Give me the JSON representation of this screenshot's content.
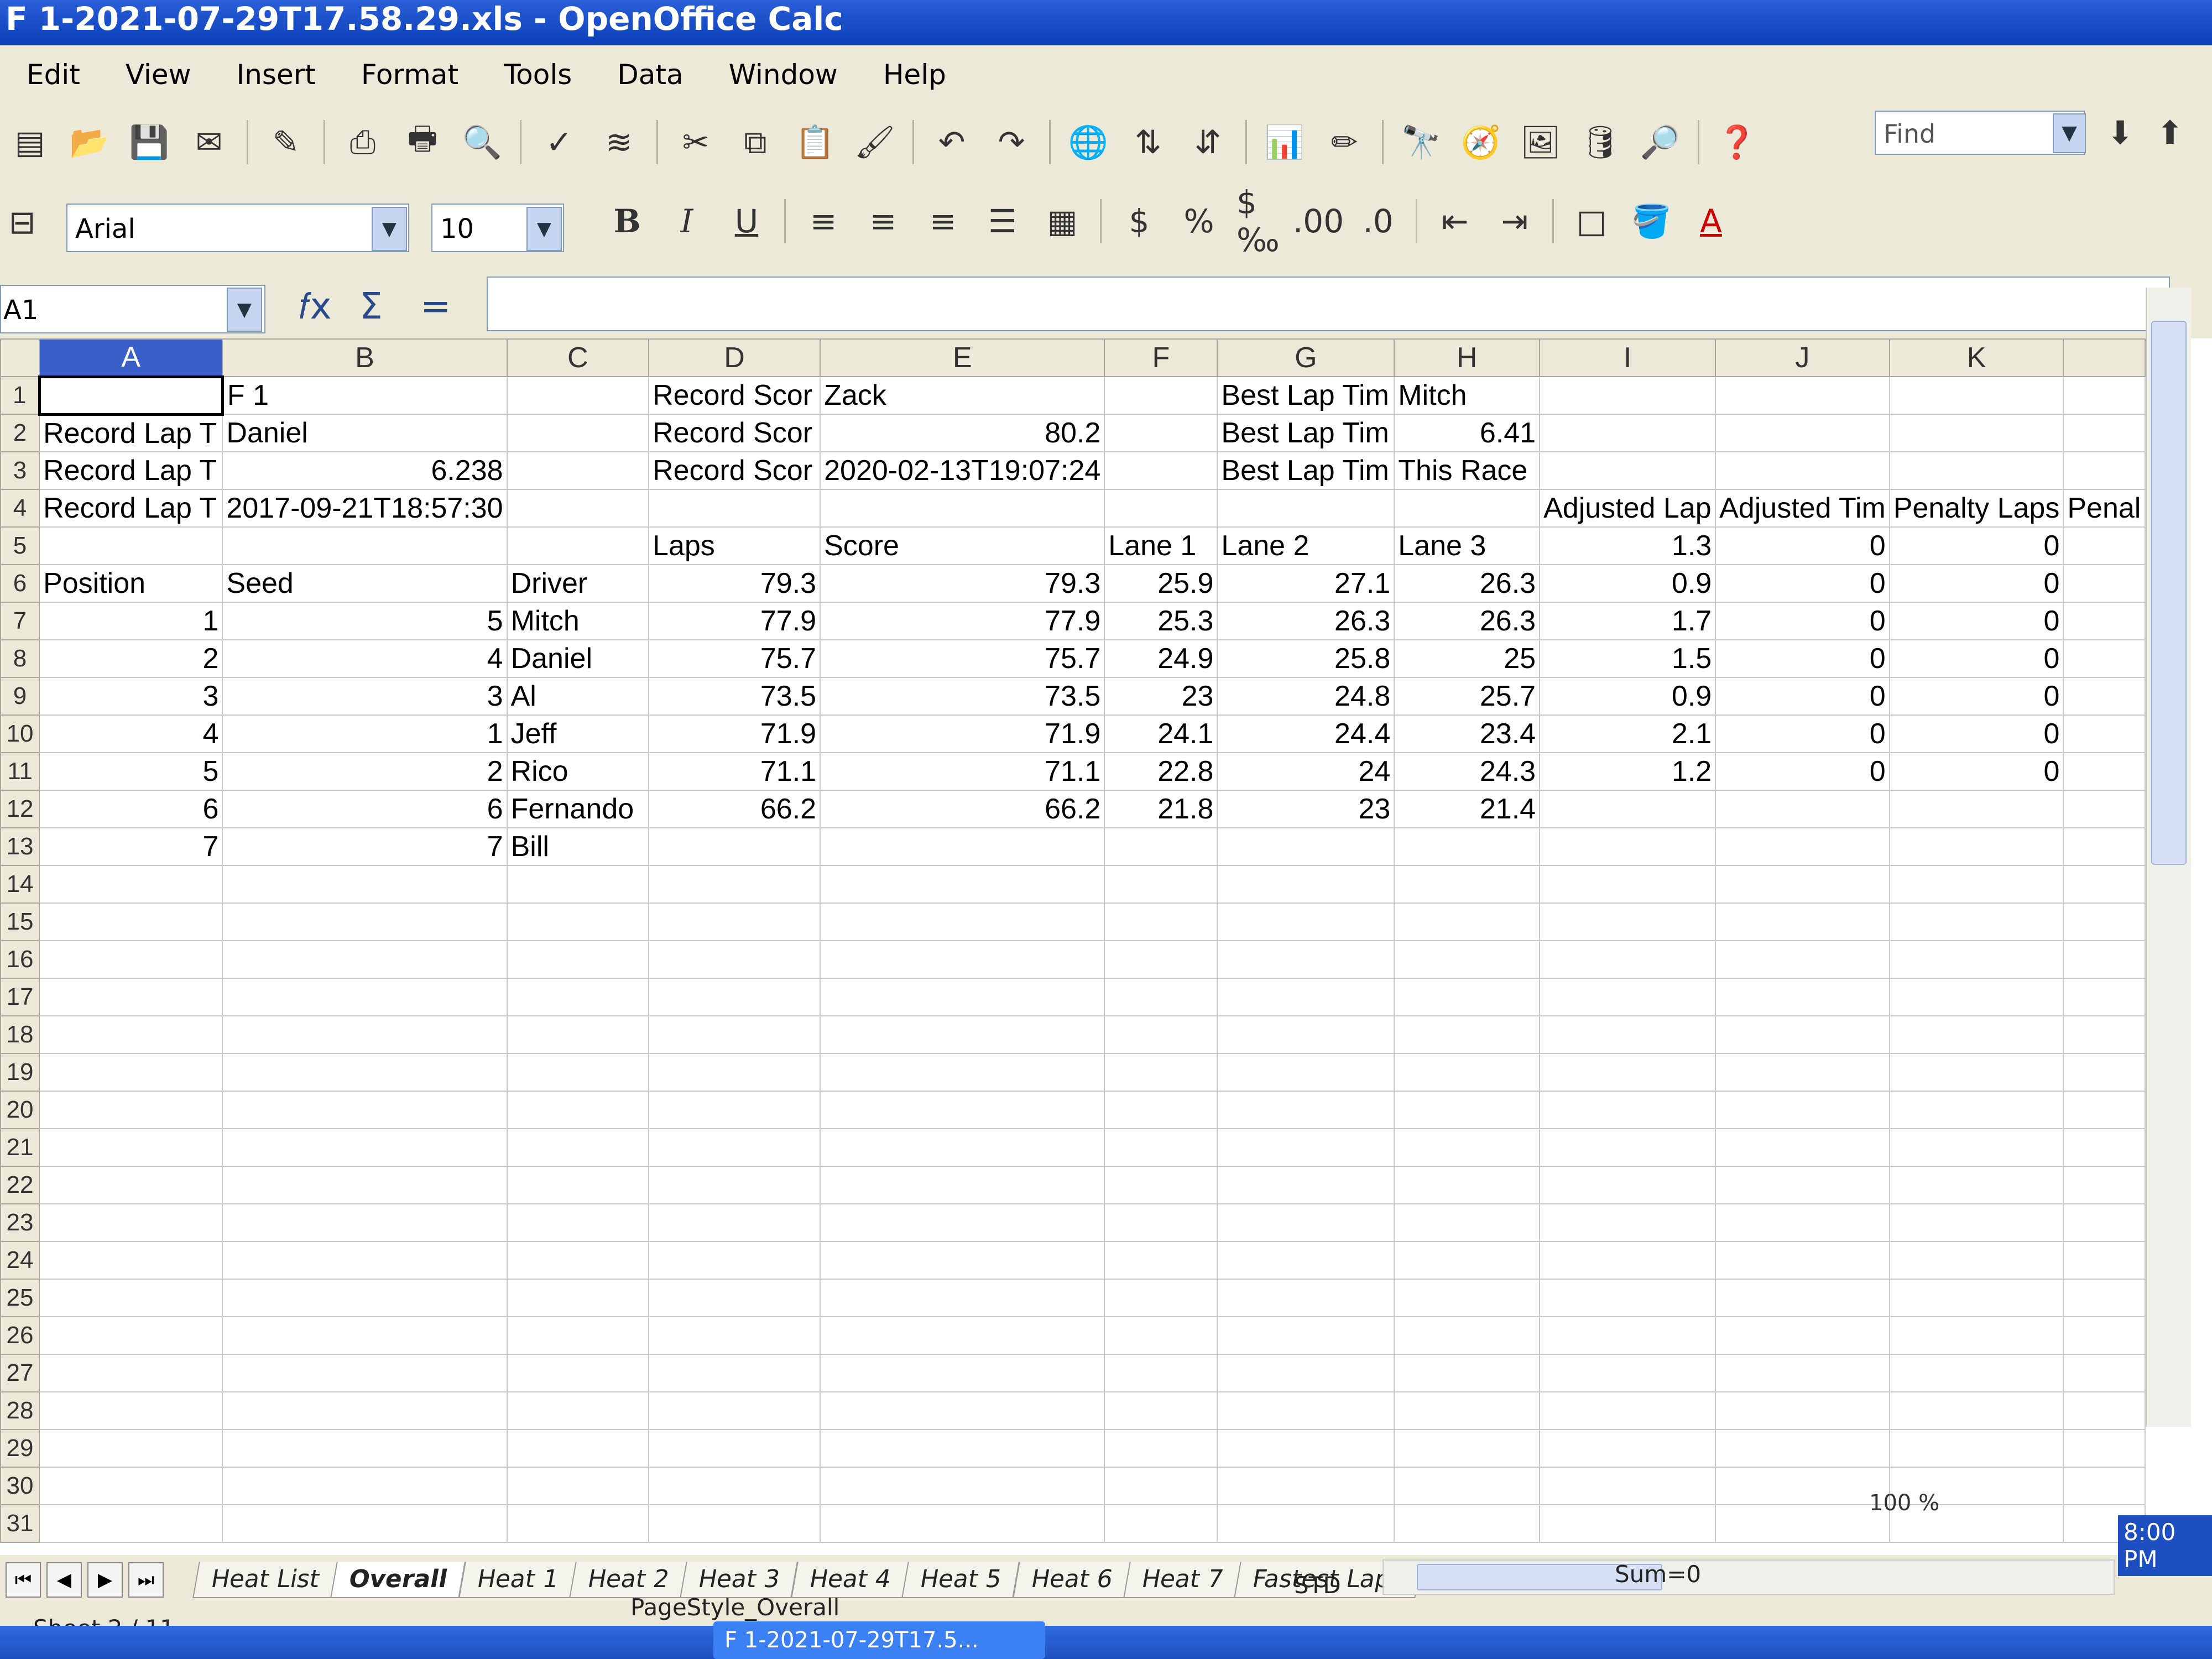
{
  "window": {
    "title": "F 1-2021-07-29T17.58.29.xls - OpenOffice Calc"
  },
  "menu": [
    "Edit",
    "View",
    "Insert",
    "Format",
    "Tools",
    "Data",
    "Window",
    "Help"
  ],
  "toolbar": {
    "find_placeholder": "Find",
    "font_name": "Arial",
    "font_size": "10"
  },
  "formula": {
    "name_box": "A1",
    "content": ""
  },
  "columns": [
    "A",
    "B",
    "C",
    "D",
    "E",
    "F",
    "G",
    "H",
    "I",
    "J",
    "K"
  ],
  "rows": [
    {
      "n": "1",
      "cells": [
        "",
        "F 1",
        "",
        "Record Scor",
        "Zack",
        "",
        "Best Lap Tim",
        "Mitch",
        "",
        "",
        ""
      ]
    },
    {
      "n": "2",
      "cells": [
        "Record Lap T",
        "Daniel",
        "",
        "Record Scor",
        "80.2",
        "",
        "Best Lap Tim",
        "6.41",
        "",
        "",
        ""
      ]
    },
    {
      "n": "3",
      "cells": [
        "Record Lap T",
        "6.238",
        "",
        "Record Scor",
        "2020-02-13T19:07:24",
        "",
        "Best Lap Tim",
        "This Race",
        "",
        "",
        ""
      ]
    },
    {
      "n": "4",
      "cells": [
        "Record Lap T",
        "2017-09-21T18:57:30",
        "",
        "",
        "",
        "",
        "",
        "",
        "Adjusted Lap",
        "Adjusted Tim",
        "Penalty Laps"
      ]
    },
    {
      "n": "5",
      "cells": [
        "",
        "",
        "",
        "Laps",
        "Score",
        "Lane 1",
        "Lane 2",
        "Lane 3",
        "1.3",
        "0",
        "0"
      ]
    },
    {
      "n": "6",
      "cells": [
        "Position",
        "Seed",
        "Driver",
        "79.3",
        "79.3",
        "25.9",
        "27.1",
        "26.3",
        "0.9",
        "0",
        "0"
      ]
    },
    {
      "n": "7",
      "cells": [
        "1",
        "5",
        "Mitch",
        "77.9",
        "77.9",
        "25.3",
        "26.3",
        "26.3",
        "1.7",
        "0",
        "0"
      ]
    },
    {
      "n": "8",
      "cells": [
        "2",
        "4",
        "Daniel",
        "75.7",
        "75.7",
        "24.9",
        "25.8",
        "25",
        "1.5",
        "0",
        "0"
      ]
    },
    {
      "n": "9",
      "cells": [
        "3",
        "3",
        "Al",
        "73.5",
        "73.5",
        "23",
        "24.8",
        "25.7",
        "0.9",
        "0",
        "0"
      ]
    },
    {
      "n": "10",
      "cells": [
        "4",
        "1",
        "Jeff",
        "71.9",
        "71.9",
        "24.1",
        "24.4",
        "23.4",
        "2.1",
        "0",
        "0"
      ]
    },
    {
      "n": "11",
      "cells": [
        "5",
        "2",
        "Rico",
        "71.1",
        "71.1",
        "22.8",
        "24",
        "24.3",
        "1.2",
        "0",
        "0"
      ]
    },
    {
      "n": "12",
      "cells": [
        "6",
        "6",
        "Fernando",
        "66.2",
        "66.2",
        "21.8",
        "23",
        "21.4",
        "",
        "",
        ""
      ]
    },
    {
      "n": "13",
      "cells": [
        "7",
        "7",
        "Bill",
        "",
        "",
        "",
        "",
        "",
        "",
        "",
        ""
      ]
    },
    {
      "n": "14",
      "cells": [
        "",
        "",
        "",
        "",
        "",
        "",
        "",
        "",
        "",
        "",
        ""
      ]
    },
    {
      "n": "15",
      "cells": [
        "",
        "",
        "",
        "",
        "",
        "",
        "",
        "",
        "",
        "",
        ""
      ]
    },
    {
      "n": "16",
      "cells": [
        "",
        "",
        "",
        "",
        "",
        "",
        "",
        "",
        "",
        "",
        ""
      ]
    },
    {
      "n": "17",
      "cells": [
        "",
        "",
        "",
        "",
        "",
        "",
        "",
        "",
        "",
        "",
        ""
      ]
    },
    {
      "n": "18",
      "cells": [
        "",
        "",
        "",
        "",
        "",
        "",
        "",
        "",
        "",
        "",
        ""
      ]
    },
    {
      "n": "19",
      "cells": [
        "",
        "",
        "",
        "",
        "",
        "",
        "",
        "",
        "",
        "",
        ""
      ]
    },
    {
      "n": "20",
      "cells": [
        "",
        "",
        "",
        "",
        "",
        "",
        "",
        "",
        "",
        "",
        ""
      ]
    },
    {
      "n": "21",
      "cells": [
        "",
        "",
        "",
        "",
        "",
        "",
        "",
        "",
        "",
        "",
        ""
      ]
    },
    {
      "n": "22",
      "cells": [
        "",
        "",
        "",
        "",
        "",
        "",
        "",
        "",
        "",
        "",
        ""
      ]
    },
    {
      "n": "23",
      "cells": [
        "",
        "",
        "",
        "",
        "",
        "",
        "",
        "",
        "",
        "",
        ""
      ]
    },
    {
      "n": "24",
      "cells": [
        "",
        "",
        "",
        "",
        "",
        "",
        "",
        "",
        "",
        "",
        ""
      ]
    },
    {
      "n": "25",
      "cells": [
        "",
        "",
        "",
        "",
        "",
        "",
        "",
        "",
        "",
        "",
        ""
      ]
    },
    {
      "n": "26",
      "cells": [
        "",
        "",
        "",
        "",
        "",
        "",
        "",
        "",
        "",
        "",
        ""
      ]
    },
    {
      "n": "27",
      "cells": [
        "",
        "",
        "",
        "",
        "",
        "",
        "",
        "",
        "",
        "",
        ""
      ]
    },
    {
      "n": "28",
      "cells": [
        "",
        "",
        "",
        "",
        "",
        "",
        "",
        "",
        "",
        "",
        ""
      ]
    },
    {
      "n": "29",
      "cells": [
        "",
        "",
        "",
        "",
        "",
        "",
        "",
        "",
        "",
        "",
        ""
      ]
    },
    {
      "n": "30",
      "cells": [
        "",
        "",
        "",
        "",
        "",
        "",
        "",
        "",
        "",
        "",
        ""
      ]
    },
    {
      "n": "31",
      "cells": [
        "",
        "",
        "",
        "",
        "",
        "",
        "",
        "",
        "",
        "",
        ""
      ]
    }
  ],
  "extra_header": "Penal",
  "sheet_tabs": [
    "Heat List",
    "Overall",
    "Heat 1",
    "Heat 2",
    "Heat 3",
    "Heat 4",
    "Heat 5",
    "Heat 6",
    "Heat 7",
    "Fastest Laps"
  ],
  "active_tab": "Overall",
  "status": {
    "sheet": "Sheet 2 / 11",
    "page_style": "PageStyle_Overall",
    "mode": "STD",
    "sum": "Sum=0",
    "zoom": "100 %"
  },
  "taskbar": {
    "item": "F 1-2021-07-29T17.5...",
    "clock": "8:00 PM"
  },
  "colors": {
    "title": "#0a3fb8",
    "selected_header": "#3a5fc8",
    "chrome": "#ece9d8"
  }
}
